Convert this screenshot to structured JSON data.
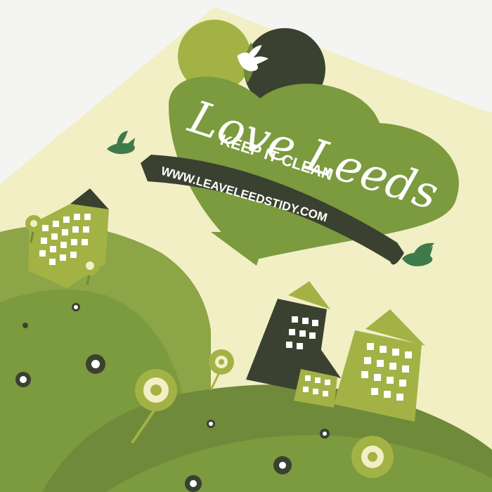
{
  "card": {
    "headline": "Love Leeds",
    "tagline": "KEEP IT CLEAN",
    "website": "WWW.LEAVELEEDSTIDY.COM"
  },
  "palette": {
    "background": "#f4f4f2",
    "card": "#f2efc5",
    "heart": "#7c9a3e",
    "olive_light": "#a3b245",
    "olive_dark": "#3a4130",
    "hill_mid": "#8ba547",
    "hill_dark": "#6f8a3a",
    "bird_green": "#3f7a4a",
    "white": "#ffffff"
  },
  "icons": [
    "dove-icon",
    "bird-icon",
    "house-icon",
    "flower-icon"
  ]
}
